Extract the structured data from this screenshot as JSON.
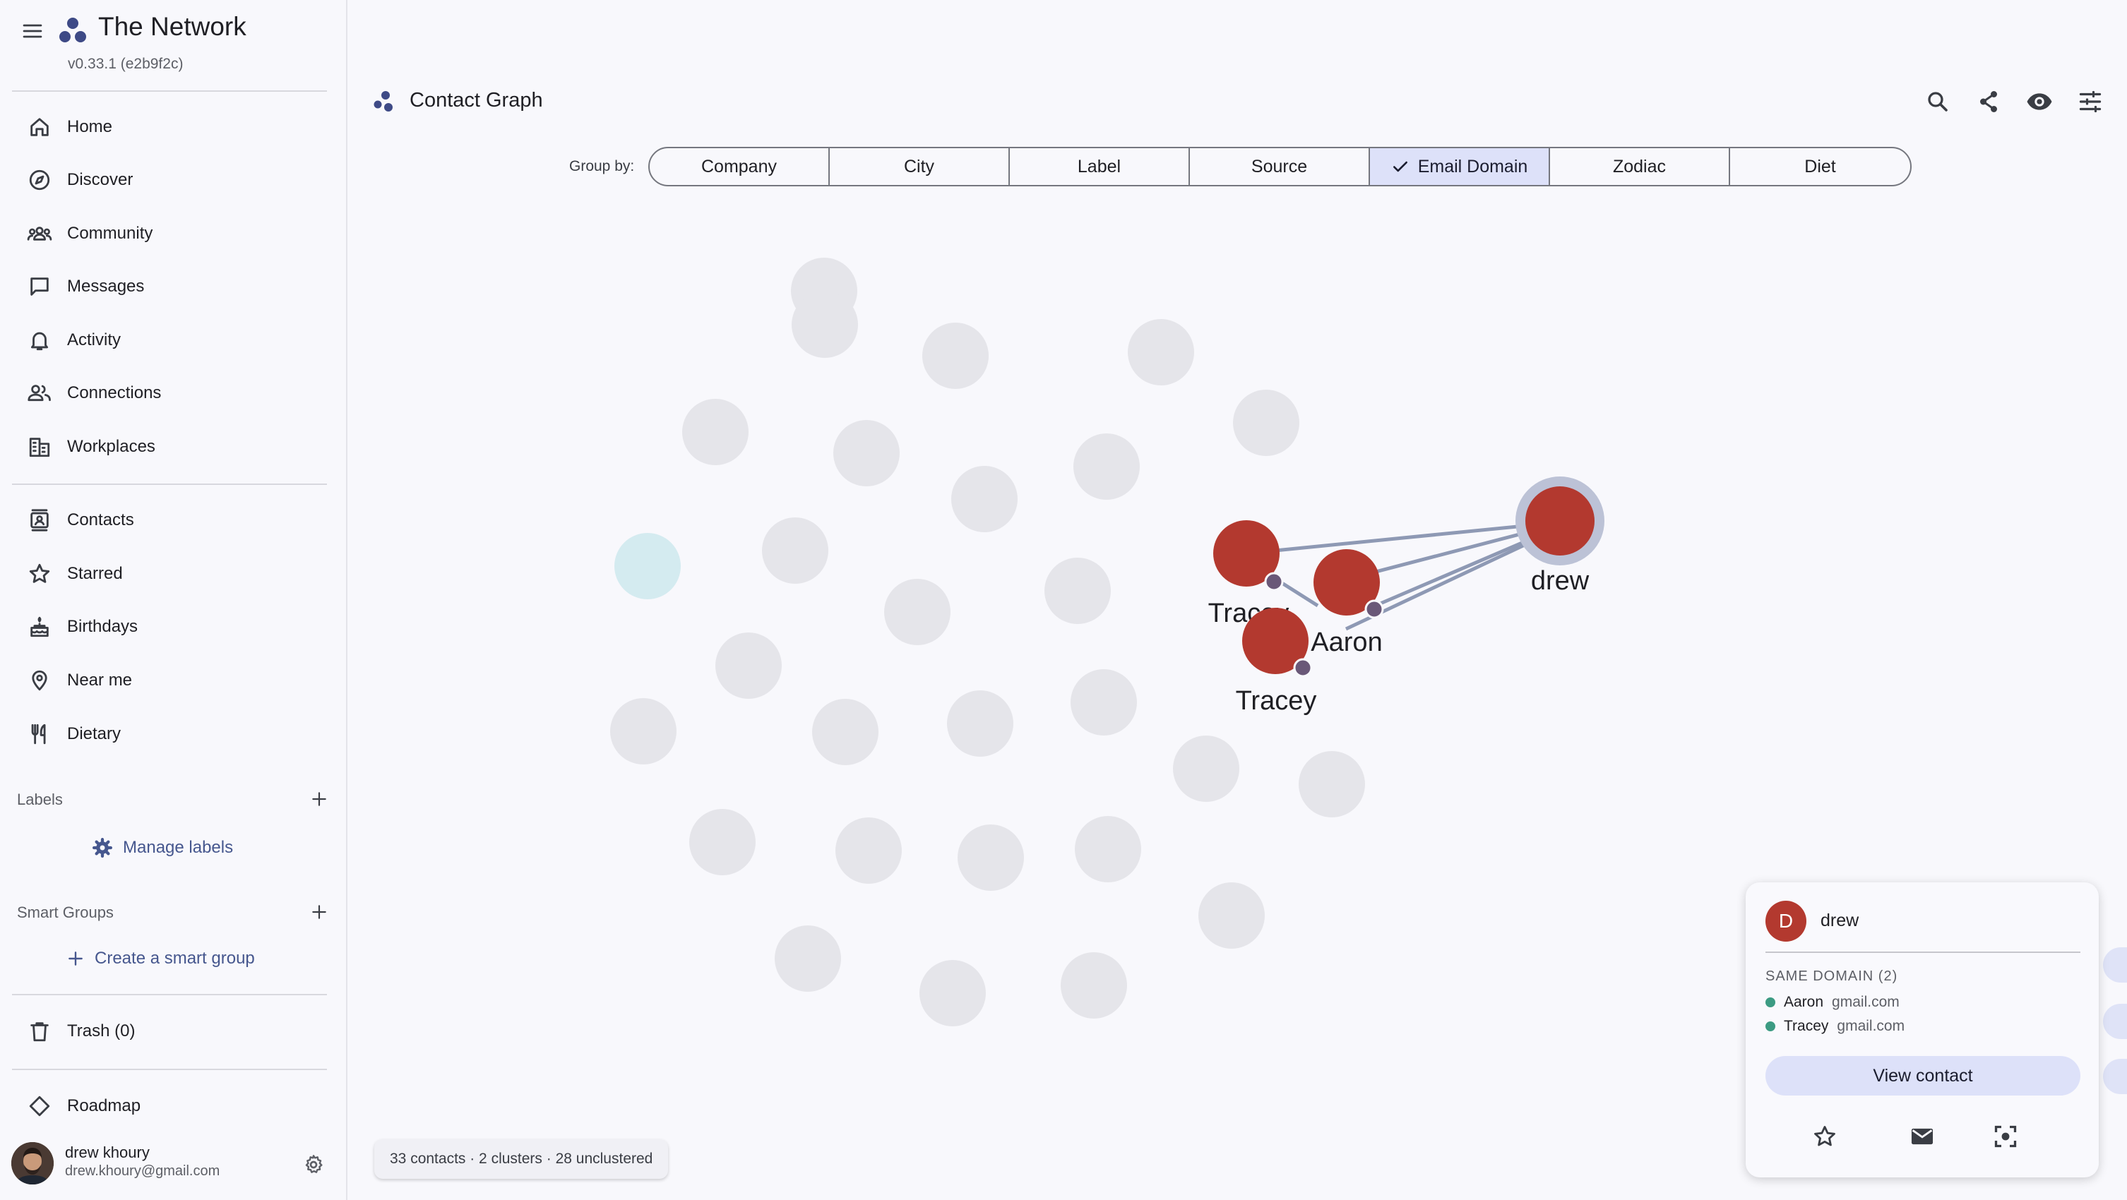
{
  "app": {
    "title": "The Network",
    "version": "v0.33.1 (e2b9f2c)"
  },
  "nav": {
    "primary": [
      {
        "label": "Home",
        "icon": "home-icon"
      },
      {
        "label": "Discover",
        "icon": "compass-icon"
      },
      {
        "label": "Community",
        "icon": "groups-icon"
      },
      {
        "label": "Messages",
        "icon": "chat-icon"
      },
      {
        "label": "Activity",
        "icon": "bell-icon"
      },
      {
        "label": "Connections",
        "icon": "people-icon"
      },
      {
        "label": "Workplaces",
        "icon": "building-icon"
      }
    ],
    "secondary": [
      {
        "label": "Contacts",
        "icon": "contacts-icon"
      },
      {
        "label": "Starred",
        "icon": "star-icon"
      },
      {
        "label": "Birthdays",
        "icon": "cake-icon"
      },
      {
        "label": "Near me",
        "icon": "location-pin-icon"
      },
      {
        "label": "Dietary",
        "icon": "utensils-icon"
      }
    ],
    "labels_heading": "Labels",
    "manage_labels": "Manage labels",
    "smart_groups_heading": "Smart Groups",
    "create_smart_group": "Create a smart group",
    "trash": "Trash (0)",
    "roadmap": "Roadmap"
  },
  "user": {
    "name": "drew khoury",
    "email": "drew.khoury@gmail.com"
  },
  "page": {
    "title": "Contact Graph",
    "toolbar_icons": [
      "search-icon",
      "share-icon",
      "eye-icon",
      "tune-icon"
    ]
  },
  "groupby": {
    "label": "Group by:",
    "options": [
      "Company",
      "City",
      "Label",
      "Source",
      "Email Domain",
      "Zodiac",
      "Diet"
    ],
    "selected": "Email Domain"
  },
  "graph": {
    "colors": {
      "cluster_node": "#b3392f",
      "ghost_node": "#e5e5ea",
      "highlight_node": "#d4ebf0",
      "edge": "#8e99b4",
      "badge": "#6a5878",
      "focus_ring": "#bcc2d6"
    },
    "labels": {
      "drew": "drew",
      "tracey_top": "Tracey",
      "aaron": "Aaron",
      "tracey_bottom": "Tracey"
    }
  },
  "status": {
    "summary": "33 contacts · 2 clusters · 28 unclustered"
  },
  "card": {
    "initial": "D",
    "name": "drew",
    "section": "SAME DOMAIN (2)",
    "same_domain": [
      {
        "name": "Aaron",
        "domain": "gmail.com"
      },
      {
        "name": "Tracey",
        "domain": "gmail.com"
      }
    ],
    "view_button": "View contact",
    "actions": [
      "star-icon",
      "mail-icon",
      "focus-icon"
    ]
  }
}
